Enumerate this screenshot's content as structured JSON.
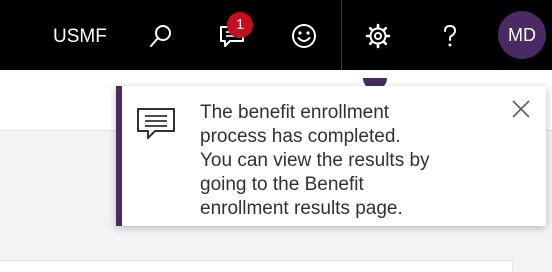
{
  "header": {
    "company": "USMF",
    "notification_count": "1",
    "avatar_initials": "MD",
    "brand_color": "#4a2a63",
    "badge_color": "#c50f1f",
    "icons": {
      "search": "search-icon",
      "notifications": "message-notification-icon",
      "feedback": "smiley-icon",
      "settings": "gear-icon",
      "help": "question-icon"
    }
  },
  "toast": {
    "icon": "message-icon",
    "message": "The benefit enrollment\nprocess has completed.\nYou can view the results by\ngoing to the Benefit\nenrollment results page.",
    "close_icon": "close-icon"
  }
}
